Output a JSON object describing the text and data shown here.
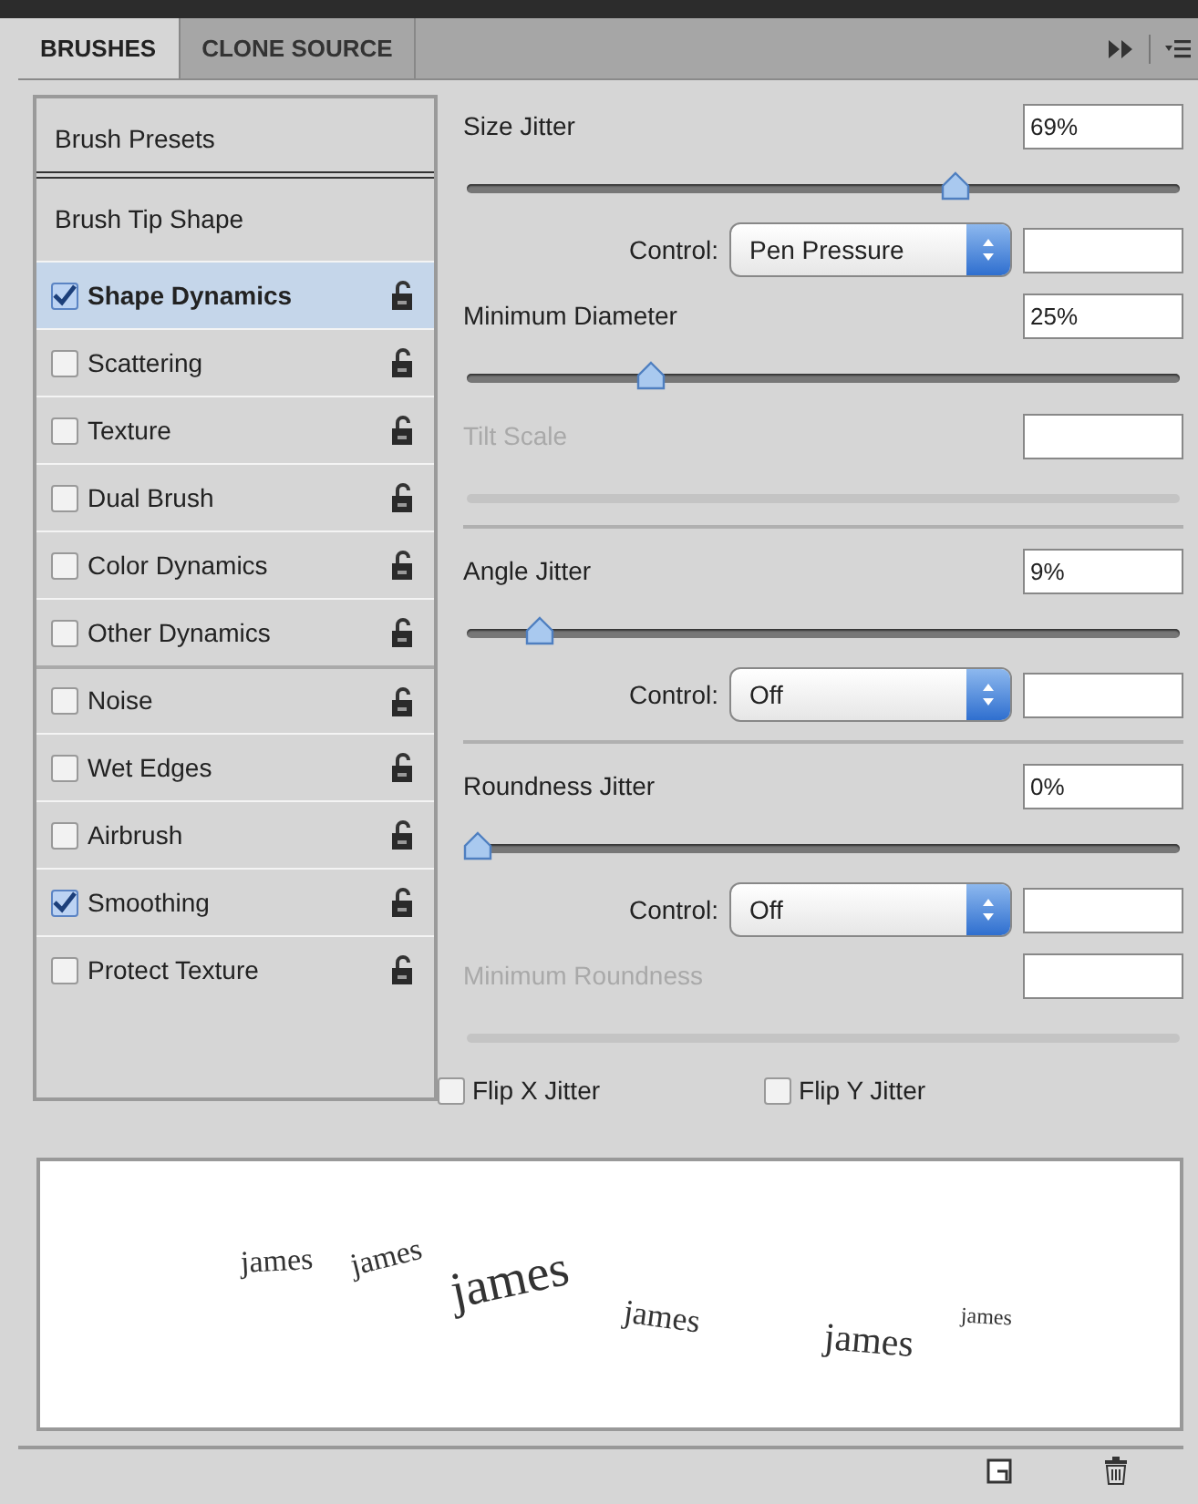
{
  "tabs": [
    {
      "label": "BRUSHES",
      "selected": true
    },
    {
      "label": "CLONE SOURCE",
      "selected": false
    }
  ],
  "sidebar": {
    "headers": [
      {
        "label": "Brush Presets",
        "selected": false
      },
      {
        "label": "Brush Tip Shape",
        "selected": false
      }
    ],
    "groups": [
      [
        {
          "label": "Shape Dynamics",
          "checked": true,
          "selected": true
        },
        {
          "label": "Scattering",
          "checked": false,
          "selected": false
        },
        {
          "label": "Texture",
          "checked": false,
          "selected": false
        },
        {
          "label": "Dual Brush",
          "checked": false,
          "selected": false
        },
        {
          "label": "Color Dynamics",
          "checked": false,
          "selected": false
        },
        {
          "label": "Other Dynamics",
          "checked": false,
          "selected": false
        }
      ],
      [
        {
          "label": "Noise",
          "checked": false,
          "selected": false
        },
        {
          "label": "Wet Edges",
          "checked": false,
          "selected": false
        },
        {
          "label": "Airbrush",
          "checked": false,
          "selected": false
        },
        {
          "label": "Smoothing",
          "checked": true,
          "selected": false
        },
        {
          "label": "Protect Texture",
          "checked": false,
          "selected": false
        }
      ]
    ]
  },
  "settings": [
    {
      "kind": "slider",
      "label": "Size Jitter",
      "value": "69%",
      "level": 0.69,
      "disabled": false
    },
    {
      "kind": "control",
      "label": "Control:",
      "value": "Pen Pressure"
    },
    {
      "kind": "slider",
      "label": "Minimum Diameter",
      "value": "25%",
      "level": 0.25,
      "disabled": false
    },
    {
      "kind": "slider",
      "label": "Tilt Scale",
      "disabled": true
    },
    {
      "kind": "divider"
    },
    {
      "kind": "slider",
      "label": "Angle Jitter",
      "value": "9%",
      "level": 0.09,
      "disabled": false
    },
    {
      "kind": "control",
      "label": "Control:",
      "value": "Off"
    },
    {
      "kind": "divider"
    },
    {
      "kind": "slider",
      "label": "Roundness Jitter",
      "value": "0%",
      "level": 0,
      "disabled": false
    },
    {
      "kind": "control",
      "label": "Control:",
      "value": "Off"
    },
    {
      "kind": "slider",
      "label": "Minimum Roundness",
      "disabled": true
    }
  ],
  "flips": [
    {
      "label": "Flip X Jitter",
      "checked": false
    },
    {
      "label": "Flip Y Jitter",
      "checked": false
    }
  ],
  "preview": {
    "stamps": [
      "james",
      "james",
      "james",
      "james",
      "james",
      "james"
    ]
  }
}
